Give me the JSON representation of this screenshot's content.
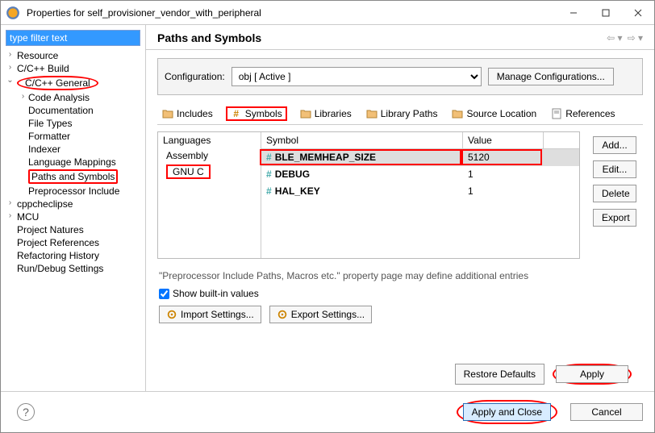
{
  "window": {
    "title": "Properties for self_provisioner_vendor_with_peripheral"
  },
  "left": {
    "filter_value": "type filter text",
    "tree": [
      {
        "label": "Resource",
        "lvl": 1,
        "expander": ">"
      },
      {
        "label": "C/C++ Build",
        "lvl": 1,
        "expander": ">"
      },
      {
        "label": "C/C++ General",
        "lvl": 1,
        "expander": "v",
        "highlighted": "oval"
      },
      {
        "label": "Code Analysis",
        "lvl": 2,
        "expander": ">"
      },
      {
        "label": "Documentation",
        "lvl": 2
      },
      {
        "label": "File Types",
        "lvl": 2
      },
      {
        "label": "Formatter",
        "lvl": 2
      },
      {
        "label": "Indexer",
        "lvl": 2
      },
      {
        "label": "Language Mappings",
        "lvl": 2
      },
      {
        "label": "Paths and Symbols",
        "lvl": 2,
        "highlighted": "box"
      },
      {
        "label": "Preprocessor Include",
        "lvl": 2
      },
      {
        "label": "cppcheclipse",
        "lvl": 1,
        "expander": ">"
      },
      {
        "label": "MCU",
        "lvl": 1,
        "expander": ">"
      },
      {
        "label": "Project Natures",
        "lvl": 1
      },
      {
        "label": "Project References",
        "lvl": 1
      },
      {
        "label": "Refactoring History",
        "lvl": 1
      },
      {
        "label": "Run/Debug Settings",
        "lvl": 1
      }
    ]
  },
  "page": {
    "title": "Paths and Symbols",
    "config_label": "Configuration:",
    "config_selected": "obj  [ Active ]",
    "manage_btn": "Manage Configurations..."
  },
  "tabs": [
    {
      "label": "Includes",
      "icon": "folder"
    },
    {
      "label": "Symbols",
      "icon": "hash",
      "highlighted": true
    },
    {
      "label": "Libraries",
      "icon": "folder"
    },
    {
      "label": "Library Paths",
      "icon": "folder"
    },
    {
      "label": "Source Location",
      "icon": "folder"
    },
    {
      "label": "References",
      "icon": "doc"
    }
  ],
  "languages": {
    "header": "Languages",
    "items": [
      "Assembly",
      "GNU C"
    ],
    "highlight_index": 1
  },
  "symbols": {
    "headers": {
      "symbol": "Symbol",
      "value": "Value"
    },
    "rows": [
      {
        "name": "BLE_MEMHEAP_SIZE",
        "value": "5120",
        "highlighted": true,
        "selected": true
      },
      {
        "name": "DEBUG",
        "value": "1"
      },
      {
        "name": "HAL_KEY",
        "value": "1"
      }
    ]
  },
  "buttons": {
    "add": "Add...",
    "edit": "Edit...",
    "delete": "Delete",
    "export": "Export"
  },
  "note": "\"Preprocessor Include Paths, Macros etc.\" property page may define additional entries",
  "show_builtin": {
    "label": "Show built-in values",
    "checked": true
  },
  "import_btn": "Import Settings...",
  "export_btn": "Export Settings...",
  "footer": {
    "restore": "Restore Defaults",
    "apply": "Apply"
  },
  "dialog": {
    "apply_close": "Apply and Close",
    "cancel": "Cancel"
  }
}
